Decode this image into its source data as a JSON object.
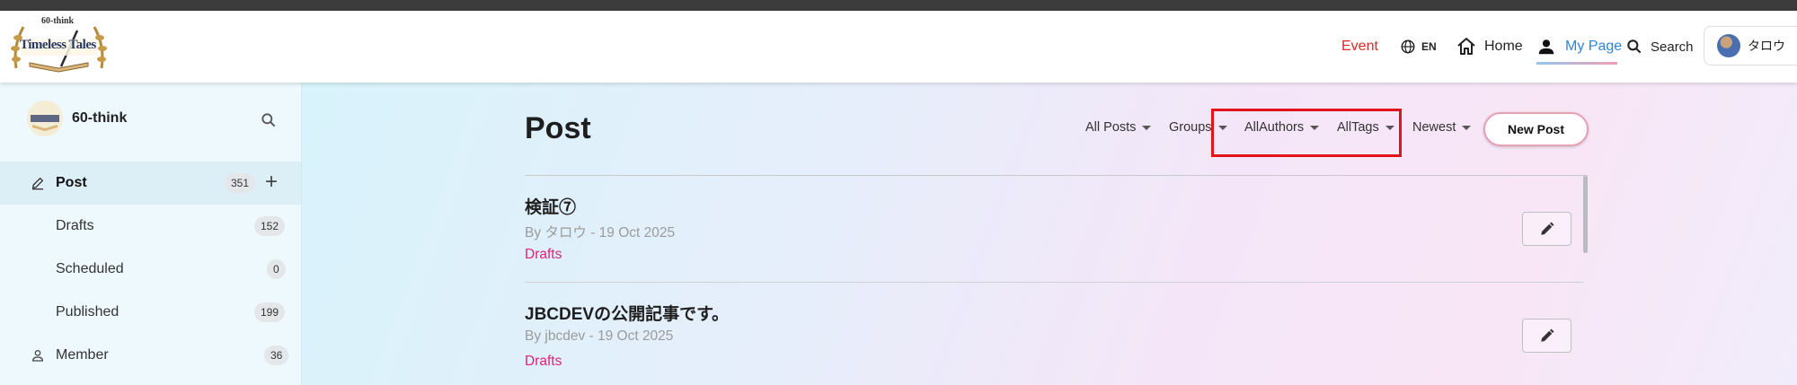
{
  "header": {
    "logo_text": "Timeless Tales",
    "logo_subtext": "60-think",
    "nav": {
      "event": "Event",
      "lang": "EN",
      "home": "Home",
      "mypage": "My Page",
      "search": "Search"
    },
    "user_name": "タロウ",
    "colors": {
      "event": "#e0262a",
      "active": "#2f84d8"
    }
  },
  "sidebar": {
    "title": "60-think",
    "items": [
      {
        "label": "Post",
        "count": "351",
        "icon": "pencil-icon",
        "active": true
      },
      {
        "label": "Drafts",
        "count": "152"
      },
      {
        "label": "Scheduled",
        "count": "0"
      },
      {
        "label": "Published",
        "count": "199"
      },
      {
        "label": "Member",
        "count": "36",
        "icon": "person-icon"
      }
    ]
  },
  "main": {
    "title": "Post",
    "filters": {
      "all_posts": "All Posts",
      "groups": "Groups",
      "authors": "AllAuthors",
      "tags": "AllTags",
      "sort": "Newest"
    },
    "new_post": "New Post",
    "posts": [
      {
        "title": "検証⑦",
        "meta": "By タロウ - 19 Oct 2025",
        "status": "Drafts"
      },
      {
        "title": "JBCDEVの公開記事です。",
        "meta": "By jbcdev - 19 Oct 2025",
        "status": "Drafts"
      }
    ]
  }
}
